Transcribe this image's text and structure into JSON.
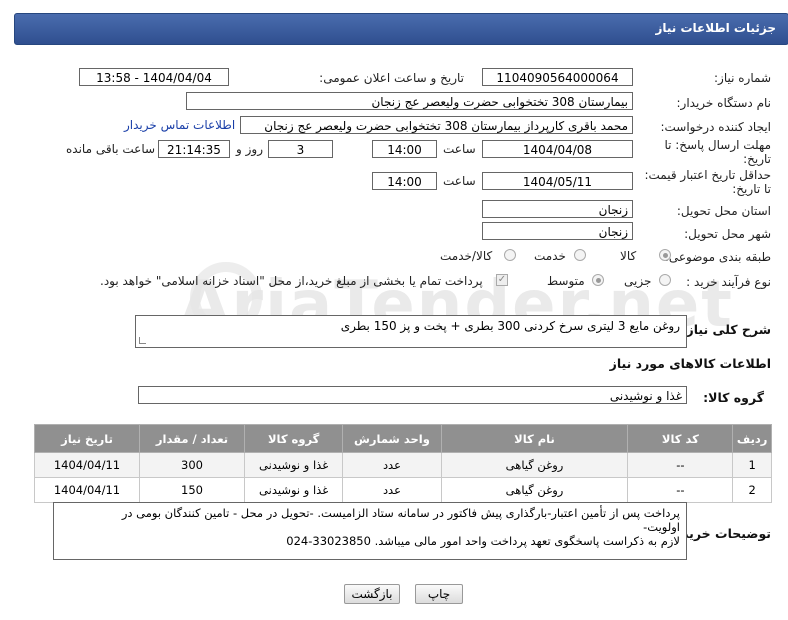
{
  "header": {
    "title": "جزئیات اطلاعات نیاز"
  },
  "watermark": {
    "text": "AriaTender.net"
  },
  "fields": {
    "need_number": {
      "label": "شماره نیاز:",
      "value": "1104090564000064"
    },
    "announce_datetime": {
      "label": "تاریخ و ساعت اعلان عمومی:",
      "value": "1404/04/04 - 13:58"
    },
    "buyer_org": {
      "label": "نام دستگاه خریدار:",
      "value": "بیمارستان 308 تختخوابی حضرت ولیعصر عج  زنجان"
    },
    "requester": {
      "label": "ایجاد کننده درخواست:",
      "value": "محمد باقری کارپرداز بیمارستان 308 تختخوابی حضرت ولیعصر عج  زنجان",
      "contact_link": "اطلاعات تماس خریدار"
    },
    "reply_deadline": {
      "label_line1": "مهلت ارسال پاسخ: تا",
      "label_line2": "تاریخ:",
      "date": "1404/04/08",
      "time_label": "ساعت",
      "time": "14:00",
      "days": "3",
      "days_label": "روز و",
      "remaining": "21:14:35",
      "remaining_label": "ساعت باقی مانده"
    },
    "price_validity": {
      "label_line1": "حداقل تاریخ اعتبار قیمت:",
      "label_line2": "تا تاریخ:",
      "date": "1404/05/11",
      "time_label": "ساعت",
      "time": "14:00"
    },
    "delivery_province": {
      "label": "استان محل تحویل:",
      "value": "زنجان"
    },
    "delivery_city": {
      "label": "شهر محل تحویل:",
      "value": "زنجان"
    },
    "category": {
      "label": "طبقه بندی موضوعی:",
      "options": [
        "کالا",
        "خدمت",
        "کالا/خدمت"
      ],
      "selected": "کالا"
    },
    "process_type": {
      "label": "نوع فرآیند خرید :",
      "options": [
        "جزیی",
        "متوسط"
      ],
      "selected": "متوسط",
      "payment_note": "پرداخت تمام یا بخشی از مبلغ خرید،از محل \"اسناد خزانه اسلامی\" خواهد بود."
    }
  },
  "description": {
    "label": "شرح کلی نیاز:",
    "value": "روغن مایع 3 لیتری سرخ کردنی 300 بطری + پخت و پز 150 بطری"
  },
  "goods_section": {
    "title": "اطلاعات کالاهای مورد نیاز",
    "group_label": "گروه کالا:",
    "group_value": "غذا و نوشیدنی"
  },
  "table": {
    "columns": [
      "ردیف",
      "کد کالا",
      "نام کالا",
      "واحد شمارش",
      "گروه کالا",
      "تعداد / مقدار",
      "تاریخ نیاز"
    ],
    "rows": [
      [
        "1",
        "--",
        "روغن گیاهی",
        "عدد",
        "غذا و نوشیدنی",
        "300",
        "1404/04/11"
      ],
      [
        "2",
        "--",
        "روغن گیاهی",
        "عدد",
        "غذا و نوشیدنی",
        "150",
        "1404/04/11"
      ]
    ]
  },
  "buyer_notes": {
    "label": "توضیحات خریدار:",
    "line1": "پرداخت پس از تأمین اعتبار-بارگذاری پیش فاکتور در سامانه ستاد الزامیست. -تحویل در محل - تامین کنندگان بومی در",
    "line2": "اولویت-",
    "line3": "لازم به ذکراست پاسخگوی تعهد پرداخت واحد امور مالی میباشد. 33023850-024"
  },
  "buttons": {
    "print": "چاپ",
    "back": "بازگشت"
  }
}
